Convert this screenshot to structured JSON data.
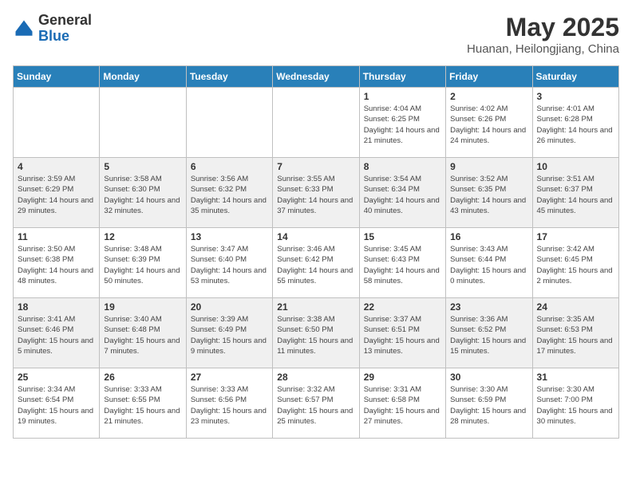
{
  "header": {
    "logo_line1": "General",
    "logo_line2": "Blue",
    "month_title": "May 2025",
    "location": "Huanan, Heilongjiang, China"
  },
  "weekdays": [
    "Sunday",
    "Monday",
    "Tuesday",
    "Wednesday",
    "Thursday",
    "Friday",
    "Saturday"
  ],
  "weeks": [
    [
      {
        "day": "",
        "info": ""
      },
      {
        "day": "",
        "info": ""
      },
      {
        "day": "",
        "info": ""
      },
      {
        "day": "",
        "info": ""
      },
      {
        "day": "1",
        "info": "Sunrise: 4:04 AM\nSunset: 6:25 PM\nDaylight: 14 hours\nand 21 minutes."
      },
      {
        "day": "2",
        "info": "Sunrise: 4:02 AM\nSunset: 6:26 PM\nDaylight: 14 hours\nand 24 minutes."
      },
      {
        "day": "3",
        "info": "Sunrise: 4:01 AM\nSunset: 6:28 PM\nDaylight: 14 hours\nand 26 minutes."
      }
    ],
    [
      {
        "day": "4",
        "info": "Sunrise: 3:59 AM\nSunset: 6:29 PM\nDaylight: 14 hours\nand 29 minutes."
      },
      {
        "day": "5",
        "info": "Sunrise: 3:58 AM\nSunset: 6:30 PM\nDaylight: 14 hours\nand 32 minutes."
      },
      {
        "day": "6",
        "info": "Sunrise: 3:56 AM\nSunset: 6:32 PM\nDaylight: 14 hours\nand 35 minutes."
      },
      {
        "day": "7",
        "info": "Sunrise: 3:55 AM\nSunset: 6:33 PM\nDaylight: 14 hours\nand 37 minutes."
      },
      {
        "day": "8",
        "info": "Sunrise: 3:54 AM\nSunset: 6:34 PM\nDaylight: 14 hours\nand 40 minutes."
      },
      {
        "day": "9",
        "info": "Sunrise: 3:52 AM\nSunset: 6:35 PM\nDaylight: 14 hours\nand 43 minutes."
      },
      {
        "day": "10",
        "info": "Sunrise: 3:51 AM\nSunset: 6:37 PM\nDaylight: 14 hours\nand 45 minutes."
      }
    ],
    [
      {
        "day": "11",
        "info": "Sunrise: 3:50 AM\nSunset: 6:38 PM\nDaylight: 14 hours\nand 48 minutes."
      },
      {
        "day": "12",
        "info": "Sunrise: 3:48 AM\nSunset: 6:39 PM\nDaylight: 14 hours\nand 50 minutes."
      },
      {
        "day": "13",
        "info": "Sunrise: 3:47 AM\nSunset: 6:40 PM\nDaylight: 14 hours\nand 53 minutes."
      },
      {
        "day": "14",
        "info": "Sunrise: 3:46 AM\nSunset: 6:42 PM\nDaylight: 14 hours\nand 55 minutes."
      },
      {
        "day": "15",
        "info": "Sunrise: 3:45 AM\nSunset: 6:43 PM\nDaylight: 14 hours\nand 58 minutes."
      },
      {
        "day": "16",
        "info": "Sunrise: 3:43 AM\nSunset: 6:44 PM\nDaylight: 15 hours\nand 0 minutes."
      },
      {
        "day": "17",
        "info": "Sunrise: 3:42 AM\nSunset: 6:45 PM\nDaylight: 15 hours\nand 2 minutes."
      }
    ],
    [
      {
        "day": "18",
        "info": "Sunrise: 3:41 AM\nSunset: 6:46 PM\nDaylight: 15 hours\nand 5 minutes."
      },
      {
        "day": "19",
        "info": "Sunrise: 3:40 AM\nSunset: 6:48 PM\nDaylight: 15 hours\nand 7 minutes."
      },
      {
        "day": "20",
        "info": "Sunrise: 3:39 AM\nSunset: 6:49 PM\nDaylight: 15 hours\nand 9 minutes."
      },
      {
        "day": "21",
        "info": "Sunrise: 3:38 AM\nSunset: 6:50 PM\nDaylight: 15 hours\nand 11 minutes."
      },
      {
        "day": "22",
        "info": "Sunrise: 3:37 AM\nSunset: 6:51 PM\nDaylight: 15 hours\nand 13 minutes."
      },
      {
        "day": "23",
        "info": "Sunrise: 3:36 AM\nSunset: 6:52 PM\nDaylight: 15 hours\nand 15 minutes."
      },
      {
        "day": "24",
        "info": "Sunrise: 3:35 AM\nSunset: 6:53 PM\nDaylight: 15 hours\nand 17 minutes."
      }
    ],
    [
      {
        "day": "25",
        "info": "Sunrise: 3:34 AM\nSunset: 6:54 PM\nDaylight: 15 hours\nand 19 minutes."
      },
      {
        "day": "26",
        "info": "Sunrise: 3:33 AM\nSunset: 6:55 PM\nDaylight: 15 hours\nand 21 minutes."
      },
      {
        "day": "27",
        "info": "Sunrise: 3:33 AM\nSunset: 6:56 PM\nDaylight: 15 hours\nand 23 minutes."
      },
      {
        "day": "28",
        "info": "Sunrise: 3:32 AM\nSunset: 6:57 PM\nDaylight: 15 hours\nand 25 minutes."
      },
      {
        "day": "29",
        "info": "Sunrise: 3:31 AM\nSunset: 6:58 PM\nDaylight: 15 hours\nand 27 minutes."
      },
      {
        "day": "30",
        "info": "Sunrise: 3:30 AM\nSunset: 6:59 PM\nDaylight: 15 hours\nand 28 minutes."
      },
      {
        "day": "31",
        "info": "Sunrise: 3:30 AM\nSunset: 7:00 PM\nDaylight: 15 hours\nand 30 minutes."
      }
    ]
  ]
}
